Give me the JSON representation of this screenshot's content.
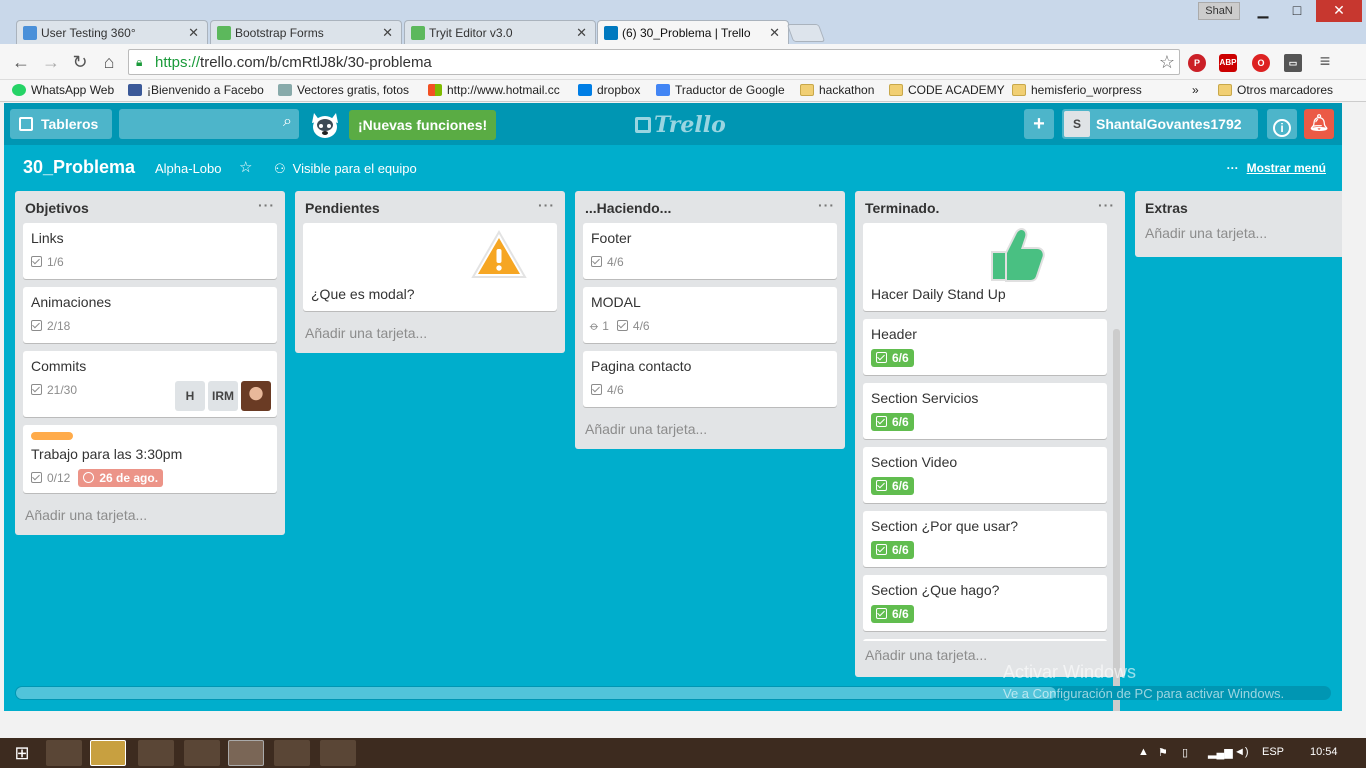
{
  "browser": {
    "tabs": [
      {
        "title": "User Testing 360°",
        "color": "#4a90d9"
      },
      {
        "title": "Bootstrap Forms",
        "color": "#5cb85c"
      },
      {
        "title": "Tryit Editor v3.0",
        "color": "#5cb85c"
      },
      {
        "title": "(6) 30_Problema | Trello",
        "color": "#0079bf"
      }
    ],
    "user": "ShaN",
    "url_scheme": "https://",
    "url_rest": "trello.com/b/cmRtlJ8k/30-problema",
    "bookmarks": [
      "WhatsApp Web",
      "¡Bienvenido a Facebo",
      "Vectores gratis, fotos",
      "http://www.hotmail.cc",
      "dropbox",
      "Traductor de Google",
      "hackathon",
      "CODE ACADEMY",
      "hemisferio_worpress"
    ],
    "more": "»",
    "other_bookmarks": "Otros marcadores"
  },
  "trello": {
    "boards_button": "Tableros",
    "new_features": "¡Nuevas funciones!",
    "logo": "Trello",
    "username": "ShantalGovantes1792",
    "avatar_initial": "S",
    "board_title": "30_Problema",
    "team": "Alpha-Lobo",
    "visibility": "Visible para el equipo",
    "show_menu": "Mostrar menú",
    "add_card": "Añadir una tarjeta...",
    "lists": [
      {
        "title": "Objetivos",
        "cards": [
          {
            "title": "Links",
            "checklist": "1/6"
          },
          {
            "title": "Animaciones",
            "checklist": "2/18"
          },
          {
            "title": "Commits",
            "checklist": "21/30",
            "members": [
              "H",
              "IRM"
            ]
          },
          {
            "title": "Trabajo para las 3:30pm",
            "checklist": "0/12",
            "due": "26 de ago.",
            "label_color": "#ffab4a"
          }
        ]
      },
      {
        "title": "Pendientes",
        "cards": [
          {
            "title": "¿Que es modal?",
            "cover_icon": "warning-sticker"
          }
        ]
      },
      {
        "title": "...Haciendo...",
        "cards": [
          {
            "title": "Footer",
            "checklist": "4/6"
          },
          {
            "title": "MODAL",
            "attachments": "1",
            "checklist": "4/6"
          },
          {
            "title": "Pagina contacto",
            "checklist": "4/6"
          }
        ]
      },
      {
        "title": "Terminado.",
        "cards": [
          {
            "title": "Hacer Daily Stand Up",
            "cover_icon": "thumbs-up-sticker"
          },
          {
            "title": "Header",
            "checklist": "6/6"
          },
          {
            "title": "Section Servicios",
            "checklist": "6/6"
          },
          {
            "title": "Section Video",
            "checklist": "6/6"
          },
          {
            "title": "Section ¿Por que usar?",
            "checklist": "6/6"
          },
          {
            "title": "Section ¿Que hago?",
            "checklist": "6/6"
          }
        ]
      },
      {
        "title": "Extras",
        "cards": []
      }
    ]
  },
  "watermark": {
    "line1": "Activar Windows",
    "line2": "Ve a Configuración de PC para activar Windows."
  },
  "taskbar": {
    "lang": "ESP",
    "time": "10:54"
  },
  "colors": {
    "board_bg": "#00aecc",
    "header_bg": "#0096b3",
    "green_badge": "#61bd4f",
    "due_badge": "#ec9488",
    "new_features": "#5aac44",
    "notification": "#eb5a46"
  }
}
